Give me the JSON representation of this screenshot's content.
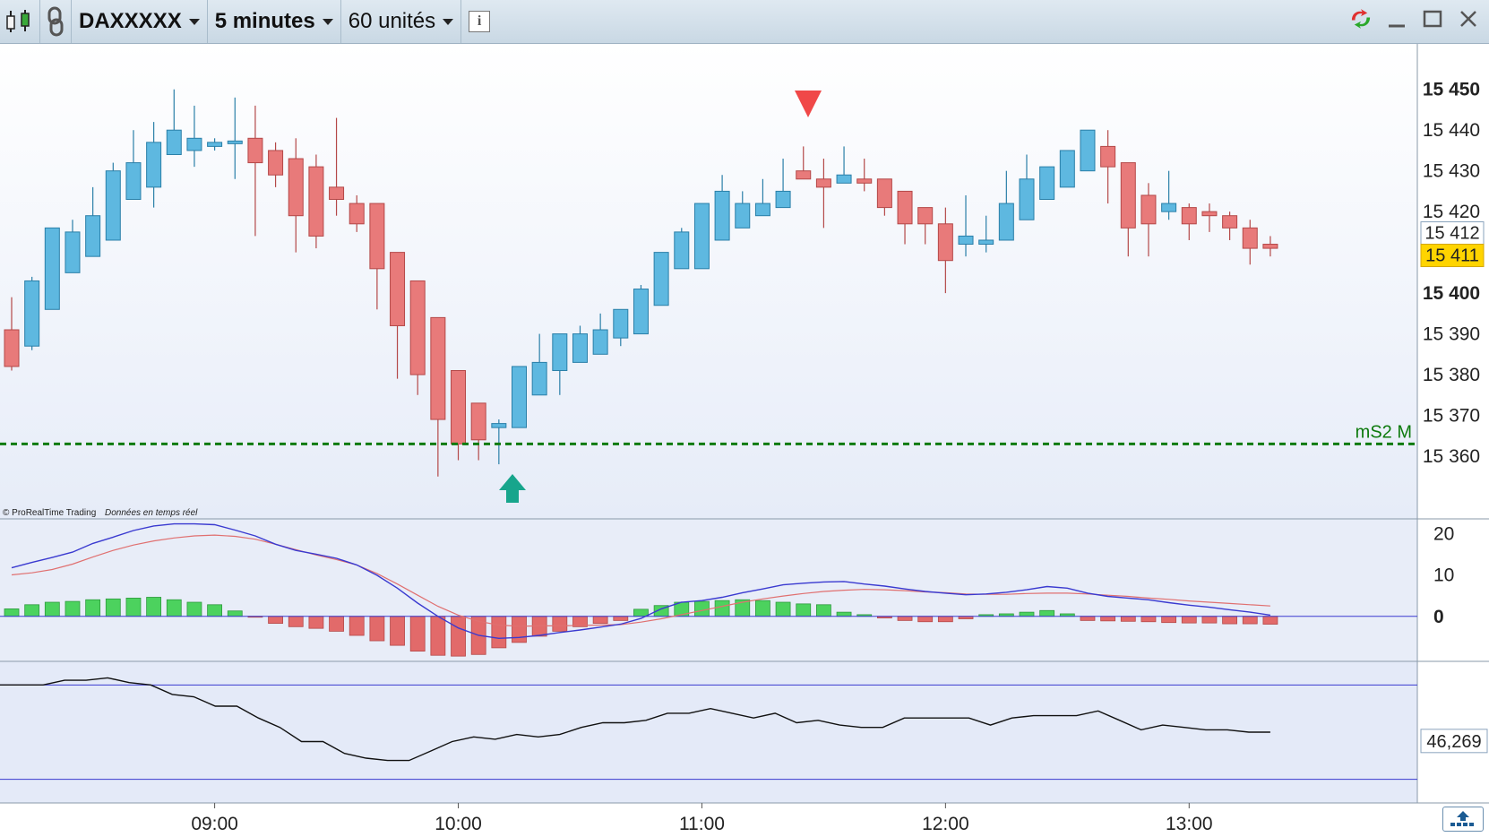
{
  "toolbar": {
    "instrument": "DAXXXXX",
    "timeframe": "5 minutes",
    "units": "60 unités",
    "info_icon": "info-icon",
    "chart_type_icon": "candlestick-chart-icon",
    "link_icon": "chain-link-icon",
    "refresh_icon": "sync-arrows-icon"
  },
  "credit": {
    "brand": "© ProRealTime Trading",
    "realtime": "Données en temps réel"
  },
  "price_panel": {
    "level_label": "mS2 M",
    "level_value": 15363,
    "last_price_label": "15 412",
    "current_price_label": "15 411",
    "last_price_value": 15412,
    "current_price_value": 15411
  },
  "indicator_panel": {
    "current_value_label": "46,269",
    "current_value": 46.269
  },
  "colors": {
    "bull": "#5eb8e0",
    "bear": "#e87a7a",
    "macd_pos": "#4cd25e",
    "macd_neg": "#e26a6a",
    "macd_line": "#3a3ad0",
    "signal_line": "#e07070",
    "level_line": "#0d7a0d",
    "panel_bg": "#e8edf8",
    "current_price_bg": "#ffd400",
    "arrow_up": "#17a58c",
    "arrow_down": "#f04848"
  },
  "chart_data": [
    {
      "type": "candlestick",
      "y_ticks": [
        15450,
        15440,
        15430,
        15420,
        15410,
        15400,
        15390,
        15380,
        15370,
        15360
      ],
      "y_tick_labels": [
        "15 450",
        "15 440",
        "15 430",
        "15 420",
        "15 400",
        "15 390",
        "15 380",
        "15 370",
        "15 360"
      ],
      "ylim": [
        15349,
        15455
      ],
      "x_tick_labels": [
        "09:00",
        "10:00",
        "11:00",
        "12:00",
        "13:00"
      ],
      "candles": [
        [
          15391,
          15399,
          15381,
          15382
        ],
        [
          15387,
          15404,
          15386,
          15403
        ],
        [
          15396,
          15416,
          15396,
          15416
        ],
        [
          15405,
          15418,
          15405,
          15415
        ],
        [
          15409,
          15426,
          15409,
          15419
        ],
        [
          15413,
          15432,
          15413,
          15430
        ],
        [
          15423,
          15440,
          15423,
          15432
        ],
        [
          15426,
          15442,
          15421,
          15437
        ],
        [
          15434,
          15450,
          15434,
          15440
        ],
        [
          15435,
          15446,
          15431,
          15438
        ],
        [
          15436,
          15438,
          15435,
          15437
        ],
        [
          15437,
          15448,
          15428,
          15437
        ],
        [
          15438,
          15446,
          15414,
          15432
        ],
        [
          15435,
          15437,
          15426,
          15429
        ],
        [
          15433,
          15438,
          15410,
          15419
        ],
        [
          15431,
          15434,
          15411,
          15414
        ],
        [
          15426,
          15443,
          15419,
          15423
        ],
        [
          15422,
          15424,
          15415,
          15417
        ],
        [
          15422,
          15422,
          15396,
          15406
        ],
        [
          15410,
          15410,
          15379,
          15392
        ],
        [
          15403,
          15403,
          15375,
          15380
        ],
        [
          15394,
          15394,
          15355,
          15369
        ],
        [
          15381,
          15381,
          15359,
          15363
        ],
        [
          15373,
          15373,
          15359,
          15364
        ],
        [
          15367,
          15369,
          15358,
          15368
        ],
        [
          15367,
          15378,
          15367,
          15382
        ],
        [
          15375,
          15390,
          15375,
          15383
        ],
        [
          15381,
          15390,
          15375,
          15390
        ],
        [
          15383,
          15392,
          15383,
          15390
        ],
        [
          15385,
          15395,
          15385,
          15391
        ],
        [
          15389,
          15395,
          15387,
          15396
        ],
        [
          15390,
          15402,
          15390,
          15401
        ],
        [
          15397,
          15410,
          15397,
          15410
        ],
        [
          15406,
          15416,
          15406,
          15415
        ],
        [
          15406,
          15421,
          15406,
          15422
        ],
        [
          15413,
          15429,
          15413,
          15425
        ],
        [
          15416,
          15425,
          15416,
          15422
        ],
        [
          15419,
          15428,
          15419,
          15422
        ],
        [
          15421,
          15433,
          15421,
          15425
        ],
        [
          15430,
          15436,
          15430,
          15428
        ],
        [
          15428,
          15433,
          15416,
          15426
        ],
        [
          15427,
          15436,
          15428,
          15429
        ],
        [
          15428,
          15433,
          15425,
          15427
        ],
        [
          15428,
          15428,
          15419,
          15421
        ],
        [
          15425,
          15425,
          15412,
          15417
        ],
        [
          15421,
          15421,
          15412,
          15417
        ],
        [
          15417,
          15421,
          15400,
          15408
        ],
        [
          15412,
          15424,
          15409,
          15414
        ],
        [
          15412,
          15419,
          15410,
          15413
        ],
        [
          15413,
          15430,
          15413,
          15422
        ],
        [
          15418,
          15434,
          15418,
          15428
        ],
        [
          15423,
          15431,
          15423,
          15431
        ],
        [
          15426,
          15433,
          15426,
          15435
        ],
        [
          15430,
          15439,
          15430,
          15440
        ],
        [
          15436,
          15440,
          15422,
          15431
        ],
        [
          15432,
          15432,
          15409,
          15416
        ],
        [
          15424,
          15427,
          15409,
          15417
        ],
        [
          15420,
          15430,
          15418,
          15422
        ],
        [
          15421,
          15422,
          15413,
          15417
        ],
        [
          15420,
          15422,
          15415,
          15419
        ],
        [
          15419,
          15420,
          15413,
          15416
        ],
        [
          15416,
          15418,
          15407,
          15411
        ],
        [
          15412,
          15414,
          15409,
          15411
        ]
      ]
    },
    {
      "type": "bar",
      "name": "histogram-and-oscillator",
      "y_ticks": [
        20,
        10,
        0
      ],
      "y_tick_labels": [
        "20",
        "10",
        "0"
      ],
      "ylim": [
        -10,
        22
      ],
      "histogram": [
        1.8,
        2.8,
        3.4,
        3.6,
        4.0,
        4.2,
        4.4,
        4.6,
        4.0,
        3.4,
        2.8,
        1.3,
        -0.1,
        -1.7,
        -2.5,
        -2.9,
        -3.6,
        -4.6,
        -5.9,
        -7.0,
        -8.4,
        -9.4,
        -9.6,
        -9.2,
        -7.6,
        -6.3,
        -4.8,
        -3.6,
        -2.5,
        -1.7,
        -1.0,
        1.7,
        2.6,
        3.4,
        3.6,
        3.8,
        4.0,
        3.8,
        3.4,
        3.0,
        2.8,
        1.0,
        0.4,
        -0.4,
        -1.0,
        -1.3,
        -1.3,
        -0.6,
        0.4,
        0.6,
        1.0,
        1.4,
        0.6,
        -1.0,
        -1.1,
        -1.2,
        -1.3,
        -1.5,
        -1.6,
        -1.6,
        -1.8,
        -1.8,
        -1.9
      ],
      "macd": [
        11.7,
        13.0,
        14.2,
        15.5,
        17.6,
        19.1,
        20.7,
        21.8,
        22.3,
        22.3,
        22.1,
        20.8,
        19.4,
        17.4,
        15.9,
        15.0,
        14.0,
        12.4,
        9.9,
        6.8,
        3.2,
        0.0,
        -2.8,
        -4.6,
        -5.3,
        -5.1,
        -4.6,
        -3.9,
        -3.3,
        -2.6,
        -1.9,
        -0.5,
        1.8,
        3.4,
        3.8,
        4.6,
        5.7,
        6.6,
        7.6,
        8.0,
        8.3,
        8.4,
        7.8,
        7.3,
        6.6,
        6.0,
        5.6,
        5.2,
        5.4,
        5.8,
        6.4,
        7.2,
        6.8,
        5.6,
        4.8,
        4.4,
        4.0,
        3.3,
        2.7,
        2.2,
        1.6,
        1.0,
        0.3
      ],
      "signal": [
        10.0,
        10.5,
        11.3,
        12.6,
        14.3,
        15.9,
        17.2,
        18.2,
        18.9,
        19.4,
        19.6,
        19.3,
        18.6,
        17.4,
        16.1,
        14.8,
        13.7,
        12.4,
        10.3,
        7.8,
        5.1,
        2.4,
        0.3,
        -1.2,
        -2.1,
        -2.4,
        -2.3,
        -2.3,
        -2.2,
        -2.1,
        -2.0,
        -1.4,
        -0.6,
        0.4,
        1.4,
        2.4,
        3.4,
        4.2,
        4.9,
        5.5,
        6.0,
        6.3,
        6.5,
        6.4,
        6.2,
        5.9,
        5.7,
        5.4,
        5.3,
        5.3,
        5.5,
        5.6,
        5.6,
        5.4,
        5.1,
        4.8,
        4.4,
        4.1,
        3.7,
        3.4,
        3.1,
        2.8,
        2.5
      ]
    },
    {
      "type": "line",
      "name": "oscillator",
      "current": 46.269,
      "upper_level": 70,
      "lower_level": 30,
      "ylim": [
        20,
        80
      ],
      "values": [
        70,
        70,
        70,
        72,
        72,
        73,
        71,
        70,
        66,
        65,
        61,
        61,
        56,
        52,
        46,
        46,
        41,
        39,
        38,
        38,
        42,
        46,
        48,
        47,
        49,
        48,
        49,
        52,
        54,
        54,
        55,
        58,
        58,
        60,
        58,
        56,
        58,
        54,
        55,
        53,
        52,
        52,
        56,
        56,
        56,
        56,
        53,
        56,
        57,
        57,
        57,
        59,
        55,
        51,
        53,
        52,
        51,
        51,
        50,
        50
      ]
    }
  ]
}
